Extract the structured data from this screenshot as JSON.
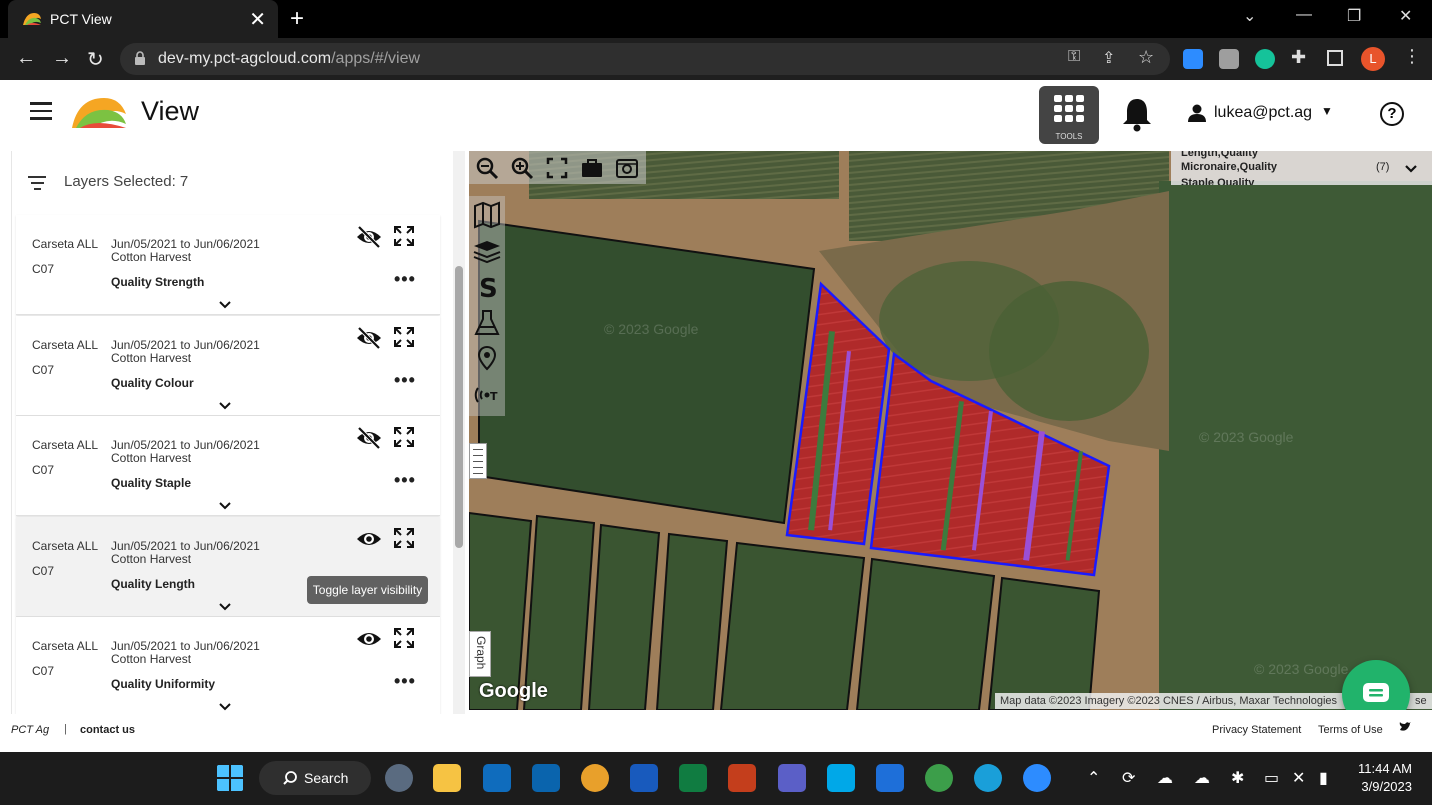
{
  "browser": {
    "tab_title": "PCT View",
    "url_host": "dev-my.pct-agcloud.com",
    "url_path": "/apps/#/view"
  },
  "app": {
    "title": "View",
    "tools_label": "TOOLS",
    "user_email": "lukea@pct.ag"
  },
  "panel": {
    "header": "Layers Selected: 7",
    "layers": [
      {
        "name": "Carseta ALL",
        "code": "C07",
        "date": "Jun/05/2021 to Jun/06/2021",
        "operation": "Cotton Harvest",
        "attribute": "Quality Strength",
        "visible": false
      },
      {
        "name": "Carseta ALL",
        "code": "C07",
        "date": "Jun/05/2021 to Jun/06/2021",
        "operation": "Cotton Harvest",
        "attribute": "Quality Colour",
        "visible": false
      },
      {
        "name": "Carseta ALL",
        "code": "C07",
        "date": "Jun/05/2021 to Jun/06/2021",
        "operation": "Cotton Harvest",
        "attribute": "Quality Staple",
        "visible": false
      },
      {
        "name": "Carseta ALL",
        "code": "C07",
        "date": "Jun/05/2021 to Jun/06/2021",
        "operation": "Cotton Harvest",
        "attribute": "Quality Length",
        "visible": true
      },
      {
        "name": "Carseta ALL",
        "code": "C07",
        "date": "Jun/05/2021 to Jun/06/2021",
        "operation": "Cotton Harvest",
        "attribute": "Quality Uniformity",
        "visible": true
      }
    ],
    "tooltip": "Toggle layer visibility"
  },
  "map": {
    "legend_line1": "Length,Quality",
    "legend_line2": "Micronaire,Quality",
    "legend_line3": "Staple Quality",
    "legend_count": "(7)",
    "graph_tab": "Graph",
    "google_logo": "Google",
    "attribution": "Map data ©2023 Imagery ©2023 CNES / Airbus, Maxar Technologies",
    "attribution_tail": "se",
    "watermark": "© 2023 Google"
  },
  "footer": {
    "company": "PCT Ag",
    "separator": "|",
    "contact": "contact us",
    "privacy": "Privacy Statement",
    "terms": "Terms of Use"
  },
  "taskbar": {
    "search_label": "Search",
    "time": "11:44 AM",
    "date": "3/9/2023"
  },
  "colors": {
    "accent_green": "#21b36b",
    "field_red": "#b02a2a",
    "field_purple": "#9b4fd6",
    "field_outline": "#1a1aff"
  }
}
